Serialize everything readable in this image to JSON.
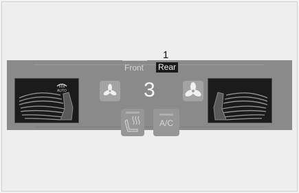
{
  "callout": {
    "number": "1"
  },
  "tabs": [
    {
      "label": "Front",
      "selected": false
    },
    {
      "label": "Rear",
      "selected": true
    }
  ],
  "fan": {
    "level": "3"
  },
  "buttons": {
    "ac_label": "A/C"
  },
  "icons": {
    "auto_climate": "auto-defrost-icon",
    "fan_low": "fan-low-icon",
    "fan_high": "fan-high-icon",
    "seat_heat": "seat-heater-icon",
    "seat_airflow": "seat-airflow-icon"
  },
  "colors": {
    "panel": "#8a8a8a",
    "selected_tab_bg": "#1a1a1a",
    "button": "#a3a3a3"
  }
}
